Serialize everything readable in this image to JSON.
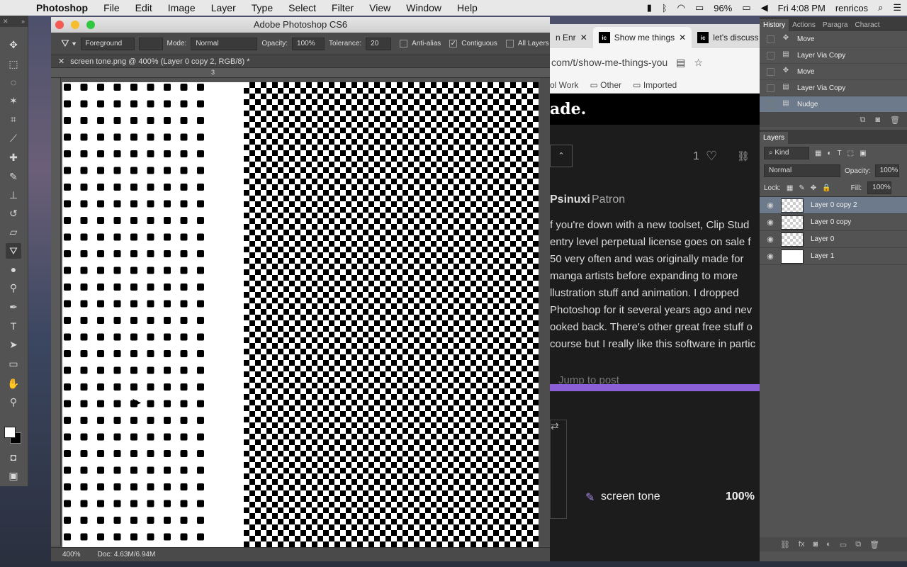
{
  "menubar": {
    "app_name": "Photoshop",
    "items": [
      "File",
      "Edit",
      "Image",
      "Layer",
      "Type",
      "Select",
      "Filter",
      "View",
      "Window",
      "Help"
    ],
    "battery": "96%",
    "clock": "Fri 4:08 PM",
    "user": "renricos"
  },
  "ps_window": {
    "title": "Adobe Photoshop CS6",
    "options": {
      "fill_source": "Foreground",
      "mode_label": "Mode:",
      "mode_value": "Normal",
      "opacity_label": "Opacity:",
      "opacity_value": "100%",
      "tolerance_label": "Tolerance:",
      "tolerance_value": "20",
      "anti_alias": "Anti-alias",
      "contiguous": "Contiguous",
      "all_layers": "All Layers",
      "contiguous_checked": true,
      "anti_alias_checked": false
    },
    "doc_tab": "screen tone.png @ 400% (Layer 0 copy 2, RGB/8) *",
    "ruler_mark": "3",
    "status": {
      "zoom": "400%",
      "doc_size": "Doc: 4.63M/6.94M"
    }
  },
  "browser": {
    "tabs": [
      {
        "label": "n Enr",
        "active": false
      },
      {
        "label": "Show me things",
        "active": true,
        "favicon": "ic"
      },
      {
        "label": "let's discuss",
        "active": false,
        "favicon": "ic"
      }
    ],
    "url": "com/t/show-me-things-you",
    "bookmarks": [
      "ol Work",
      "Other",
      "Imported"
    ],
    "heading": "ade.",
    "likes": "1",
    "author": "Psinuxi",
    "author_role": "Patron",
    "post_lines": [
      "f you're down with a new toolset, Clip Stud",
      "entry level perpetual license goes on sale f",
      "50 very often and was originally made for",
      "manga artists before expanding to more",
      "llustration stuff and animation. I dropped",
      "Photoshop for it several years ago and nev",
      "ooked back. There's other great free stuff o",
      "course but I really like this software in partic"
    ],
    "jump_link": "Jump to post",
    "file_name": "screen tone",
    "file_percent": "100%"
  },
  "history": {
    "tabs": [
      "History",
      "Actions",
      "Paragra",
      "Charact"
    ],
    "items": [
      {
        "label": "Move",
        "icon": "move-icon",
        "selected": false
      },
      {
        "label": "Layer Via Copy",
        "icon": "document-icon",
        "selected": false
      },
      {
        "label": "Move",
        "icon": "move-icon",
        "selected": false
      },
      {
        "label": "Layer Via Copy",
        "icon": "document-icon",
        "selected": false
      },
      {
        "label": "Nudge",
        "icon": "document-icon",
        "selected": true
      }
    ]
  },
  "layers": {
    "title": "Layers",
    "filter_kind": "Kind",
    "blend_mode": "Normal",
    "opacity_label": "Opacity:",
    "opacity_value": "100%",
    "lock_label": "Lock:",
    "fill_label": "Fill:",
    "fill_value": "100%",
    "items": [
      {
        "name": "Layer 0 copy 2",
        "selected": true,
        "thumb": "checker"
      },
      {
        "name": "Layer 0 copy",
        "selected": false,
        "thumb": "checker"
      },
      {
        "name": "Layer 0",
        "selected": false,
        "thumb": "checker"
      },
      {
        "name": "Layer 1",
        "selected": false,
        "thumb": "white"
      }
    ]
  },
  "colors": {
    "accent_selection": "#6d7a8b",
    "purple_bar": "#8b5fd6",
    "panel_bg": "#535353"
  }
}
